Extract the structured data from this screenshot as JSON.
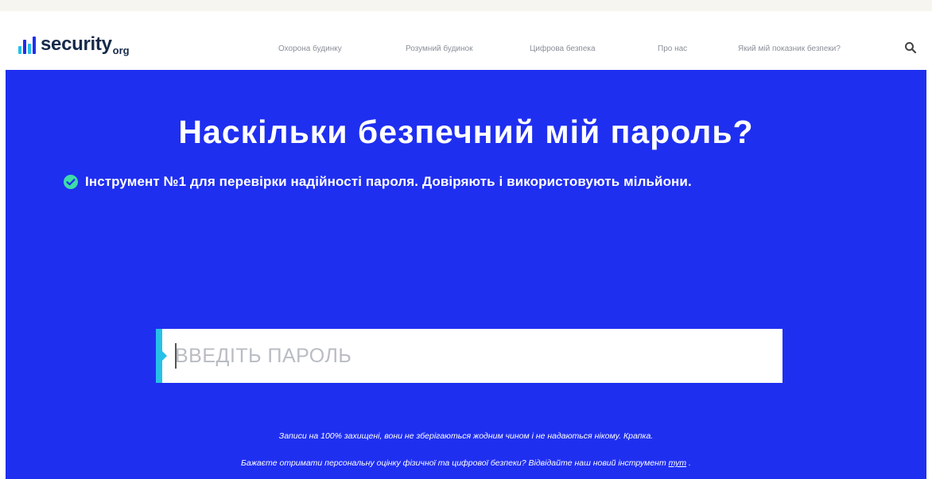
{
  "brand": {
    "name": "security",
    "suffix": "org",
    "mark_colors": [
      "#27c0e8",
      "#1f2ff0",
      "#27c0e8",
      "#1f2ff0"
    ]
  },
  "nav": {
    "items": [
      {
        "label": "Охорона будинку"
      },
      {
        "label": "Розумний будинок"
      },
      {
        "label": "Цифрова безпека"
      },
      {
        "label": "Про нас"
      },
      {
        "label": "Який мій показник безпеки?"
      }
    ],
    "search_icon": "search-icon"
  },
  "hero": {
    "title": "Наскільки безпечний мій пароль?",
    "subtitle": "Інструмент №1 для перевірки надійності пароля. Довіряють і використовують мільйони.",
    "check_icon": "check-circle-icon",
    "password_placeholder": "ВВЕДІТЬ ПАРОЛЬ",
    "password_value": "",
    "note_privacy": "Записи на 100% захищені, вони не зберігаються жодним чином і не надаються нікому. Крапка.",
    "note_promo_prefix": "Бажаєте отримати персональну оцінку фізичної та цифрової безпеки? Відвідайте наш новий інструмент",
    "note_promo_link": "тут",
    "note_promo_suffix": "."
  },
  "colors": {
    "hero_background": "#1f2ff0",
    "accent": "#27c0e8",
    "check": "#3ddca8",
    "brand_text": "#162a4a"
  }
}
